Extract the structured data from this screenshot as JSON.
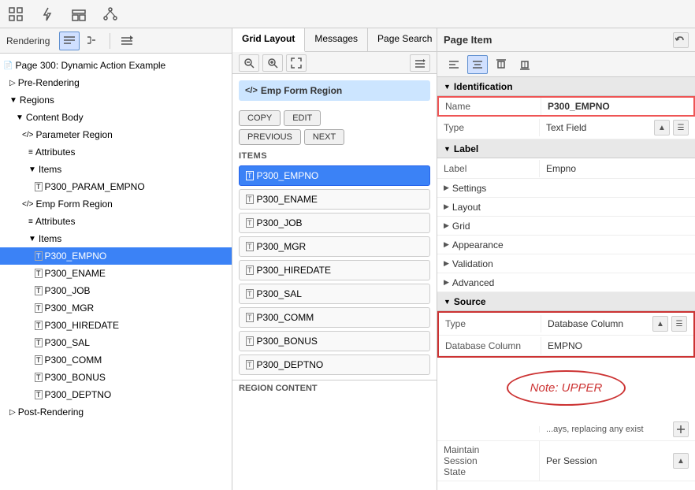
{
  "toolbar": {
    "icons": [
      "grid-icon",
      "lightning-icon",
      "component-icon",
      "tree-icon"
    ]
  },
  "left_panel": {
    "rendering_label": "Rendering",
    "tree": [
      {
        "id": "page300",
        "label": "Page 300: Dynamic Action Example",
        "indent": 0,
        "icon": "📄",
        "type": "page"
      },
      {
        "id": "pre-rendering",
        "label": "Pre-Rendering",
        "indent": 1,
        "icon": "▷",
        "type": "folder"
      },
      {
        "id": "regions",
        "label": "Regions",
        "indent": 1,
        "icon": "▼",
        "type": "folder"
      },
      {
        "id": "content-body",
        "label": "Content Body",
        "indent": 2,
        "icon": "▼",
        "type": "folder"
      },
      {
        "id": "param-region",
        "label": "Parameter Region",
        "indent": 3,
        "icon": "</>",
        "type": "region"
      },
      {
        "id": "param-attributes",
        "label": "Attributes",
        "indent": 4,
        "icon": "≡",
        "type": "attributes"
      },
      {
        "id": "param-items",
        "label": "Items",
        "indent": 4,
        "icon": "▼",
        "type": "folder"
      },
      {
        "id": "p300-param-empno",
        "label": "P300_PARAM_EMPNO",
        "indent": 5,
        "icon": "☐",
        "type": "item"
      },
      {
        "id": "emp-form-region",
        "label": "Emp Form Region",
        "indent": 3,
        "icon": "</>",
        "type": "region"
      },
      {
        "id": "emp-attributes",
        "label": "Attributes",
        "indent": 4,
        "icon": "≡",
        "type": "attributes"
      },
      {
        "id": "emp-items",
        "label": "Items",
        "indent": 4,
        "icon": "▼",
        "type": "folder",
        "selected": false
      },
      {
        "id": "p300-empno",
        "label": "P300_EMPNO",
        "indent": 5,
        "icon": "☐",
        "type": "item",
        "selected": true
      },
      {
        "id": "p300-ename",
        "label": "P300_ENAME",
        "indent": 5,
        "icon": "☐",
        "type": "item"
      },
      {
        "id": "p300-job",
        "label": "P300_JOB",
        "indent": 5,
        "icon": "☐",
        "type": "item"
      },
      {
        "id": "p300-mgr",
        "label": "P300_MGR",
        "indent": 5,
        "icon": "☐",
        "type": "item"
      },
      {
        "id": "p300-hiredate",
        "label": "P300_HIREDATE",
        "indent": 5,
        "icon": "☐",
        "type": "item"
      },
      {
        "id": "p300-sal",
        "label": "P300_SAL",
        "indent": 5,
        "icon": "☐",
        "type": "item"
      },
      {
        "id": "p300-comm",
        "label": "P300_COMM",
        "indent": 5,
        "icon": "☐",
        "type": "item"
      },
      {
        "id": "p300-bonus",
        "label": "P300_BONUS",
        "indent": 5,
        "icon": "☐",
        "type": "item"
      },
      {
        "id": "p300-deptno",
        "label": "P300_DEPTNO",
        "indent": 5,
        "icon": "☐",
        "type": "item"
      },
      {
        "id": "post-rendering",
        "label": "Post-Rendering",
        "indent": 1,
        "icon": "▷",
        "type": "folder"
      }
    ]
  },
  "middle_panel": {
    "tabs": [
      {
        "id": "grid-layout",
        "label": "Grid Layout",
        "active": true
      },
      {
        "id": "messages",
        "label": "Messages",
        "active": false
      },
      {
        "id": "page-search",
        "label": "Page Search",
        "active": false
      }
    ],
    "emp_form_region": "Emp Form Region",
    "buttons": {
      "copy": "COPY",
      "edit": "EDIT",
      "previous": "PREVIOUS",
      "next": "NEXT"
    },
    "items_label": "ITEMS",
    "items": [
      {
        "id": "p300-empno",
        "label": "P300_EMPNO",
        "selected": true
      },
      {
        "id": "p300-ename",
        "label": "P300_ENAME",
        "selected": false
      },
      {
        "id": "p300-job",
        "label": "P300_JOB",
        "selected": false
      },
      {
        "id": "p300-mgr",
        "label": "P300_MGR",
        "selected": false
      },
      {
        "id": "p300-hiredate",
        "label": "P300_HIREDATE",
        "selected": false
      },
      {
        "id": "p300-sal",
        "label": "P300_SAL",
        "selected": false
      },
      {
        "id": "p300-comm",
        "label": "P300_COMM",
        "selected": false
      },
      {
        "id": "p300-bonus",
        "label": "P300_BONUS",
        "selected": false
      },
      {
        "id": "p300-deptno",
        "label": "P300_DEPTNO",
        "selected": false
      }
    ],
    "region_content_label": "REGION CONTENT"
  },
  "right_panel": {
    "title": "Page Item",
    "sections": {
      "identification": {
        "label": "Identification",
        "expanded": true,
        "name_label": "Name",
        "name_value": "P300_EMPNO",
        "type_label": "Type",
        "type_value": "Text Field"
      },
      "label_section": {
        "label": "Label",
        "expanded": true,
        "label_label": "Label",
        "label_value": "Empno"
      },
      "settings": {
        "label": "Settings",
        "expanded": false
      },
      "layout": {
        "label": "Layout",
        "expanded": false
      },
      "grid": {
        "label": "Grid",
        "expanded": false
      },
      "appearance": {
        "label": "Appearance",
        "expanded": false
      },
      "validation": {
        "label": "Validation",
        "expanded": false
      },
      "advanced": {
        "label": "Advanced",
        "expanded": false
      },
      "source": {
        "label": "Source",
        "expanded": true,
        "type_label": "Type",
        "type_value": "Database Column",
        "db_column_label": "Database Column",
        "db_column_value": "EMPNO"
      }
    },
    "note_text": "Note: UPPER"
  }
}
